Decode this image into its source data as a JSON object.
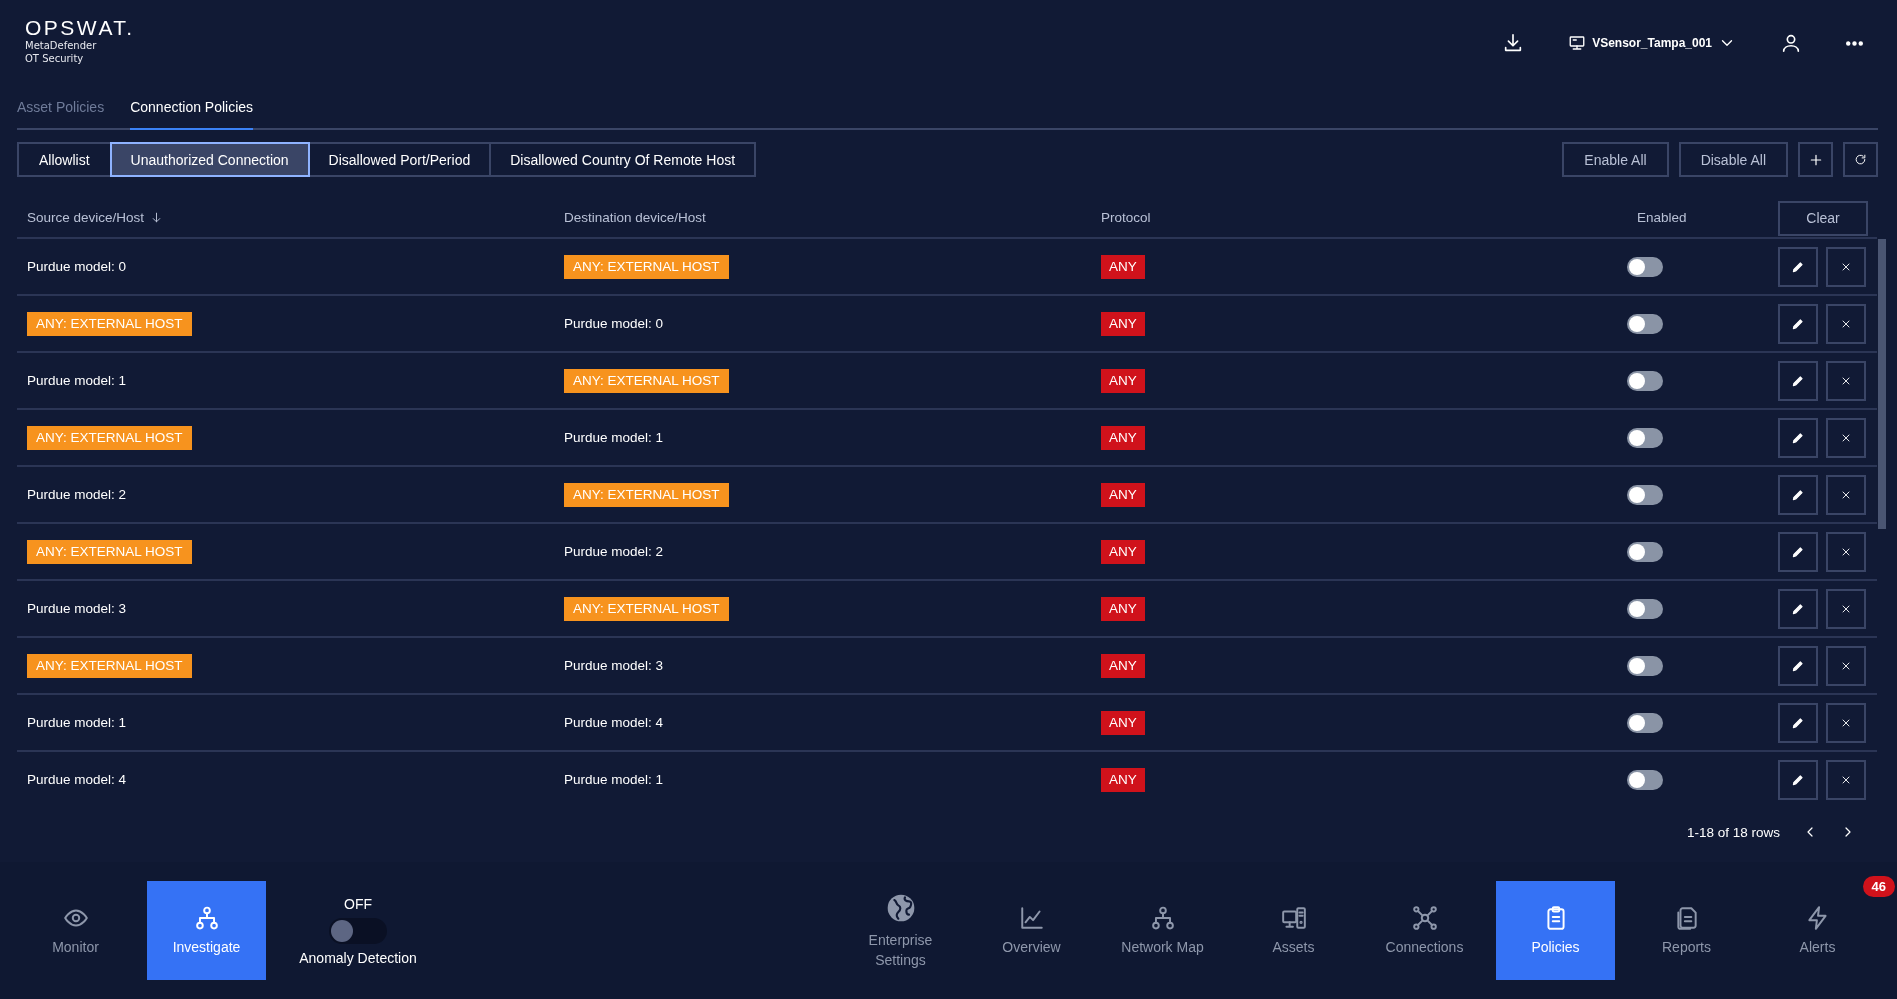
{
  "brand": {
    "logo": "OPSWAT.",
    "product_line_1": "MetaDefender",
    "product_line_2": "OT Security"
  },
  "sensor": {
    "name": "VSensor_Tampa_001"
  },
  "tabs": [
    {
      "label": "Asset Policies",
      "selected": false
    },
    {
      "label": "Connection Policies",
      "selected": true
    }
  ],
  "policy_types": [
    {
      "label": "Allowlist",
      "selected": false
    },
    {
      "label": "Unauthorized Connection",
      "selected": true
    },
    {
      "label": "Disallowed Port/Period",
      "selected": false
    },
    {
      "label": "Disallowed Country Of Remote Host",
      "selected": false
    }
  ],
  "toolbar_buttons": [
    "Enable All",
    "Disable All"
  ],
  "table": {
    "columns": [
      {
        "label": "Source device/Host",
        "sorted": true
      },
      {
        "label": "Destination device/Host",
        "sorted": false
      },
      {
        "label": "Protocol",
        "sorted": false
      },
      {
        "label": "Enabled",
        "sorted": false
      }
    ],
    "clear_button": "Clear",
    "rows": [
      {
        "source": {
          "kind": "text",
          "text": "Purdue model: 0"
        },
        "destination": {
          "kind": "tag",
          "text": "ANY: EXTERNAL HOST"
        },
        "protocol": "ANY",
        "enabled": false
      },
      {
        "source": {
          "kind": "tag",
          "text": "ANY: EXTERNAL HOST"
        },
        "destination": {
          "kind": "text",
          "text": "Purdue model: 0"
        },
        "protocol": "ANY",
        "enabled": false
      },
      {
        "source": {
          "kind": "text",
          "text": "Purdue model: 1"
        },
        "destination": {
          "kind": "tag",
          "text": "ANY: EXTERNAL HOST"
        },
        "protocol": "ANY",
        "enabled": false
      },
      {
        "source": {
          "kind": "tag",
          "text": "ANY: EXTERNAL HOST"
        },
        "destination": {
          "kind": "text",
          "text": "Purdue model: 1"
        },
        "protocol": "ANY",
        "enabled": false
      },
      {
        "source": {
          "kind": "text",
          "text": "Purdue model: 2"
        },
        "destination": {
          "kind": "tag",
          "text": "ANY: EXTERNAL HOST"
        },
        "protocol": "ANY",
        "enabled": false
      },
      {
        "source": {
          "kind": "tag",
          "text": "ANY: EXTERNAL HOST"
        },
        "destination": {
          "kind": "text",
          "text": "Purdue model: 2"
        },
        "protocol": "ANY",
        "enabled": false
      },
      {
        "source": {
          "kind": "text",
          "text": "Purdue model: 3"
        },
        "destination": {
          "kind": "tag",
          "text": "ANY: EXTERNAL HOST"
        },
        "protocol": "ANY",
        "enabled": false
      },
      {
        "source": {
          "kind": "tag",
          "text": "ANY: EXTERNAL HOST"
        },
        "destination": {
          "kind": "text",
          "text": "Purdue model: 3"
        },
        "protocol": "ANY",
        "enabled": false
      },
      {
        "source": {
          "kind": "text",
          "text": "Purdue model: 1"
        },
        "destination": {
          "kind": "text",
          "text": "Purdue model: 4"
        },
        "protocol": "ANY",
        "enabled": false
      },
      {
        "source": {
          "kind": "text",
          "text": "Purdue model: 4"
        },
        "destination": {
          "kind": "text",
          "text": "Purdue model: 1"
        },
        "protocol": "ANY",
        "enabled": false
      }
    ],
    "pagination": "1-18 of 18 rows"
  },
  "anomaly_detection": {
    "state_label": "OFF",
    "on": false,
    "label": "Anomaly Detection"
  },
  "nav_left": [
    {
      "label": "Monitor",
      "kind": "eye",
      "selected": false
    },
    {
      "label": "Investigate",
      "kind": "tree",
      "selected": true
    }
  ],
  "nav_right": [
    {
      "label": "Enterprise Settings",
      "kind": "globe",
      "selected": false
    },
    {
      "label": "Overview",
      "kind": "chart",
      "selected": false
    },
    {
      "label": "Network Map",
      "kind": "network",
      "selected": false
    },
    {
      "label": "Assets",
      "kind": "assets",
      "selected": false
    },
    {
      "label": "Connections",
      "kind": "hub",
      "selected": false
    },
    {
      "label": "Policies",
      "kind": "clipboard",
      "selected": true
    },
    {
      "label": "Reports",
      "kind": "documents",
      "selected": false
    },
    {
      "label": "Alerts",
      "kind": "bolt",
      "selected": false,
      "badge": "46"
    }
  ]
}
